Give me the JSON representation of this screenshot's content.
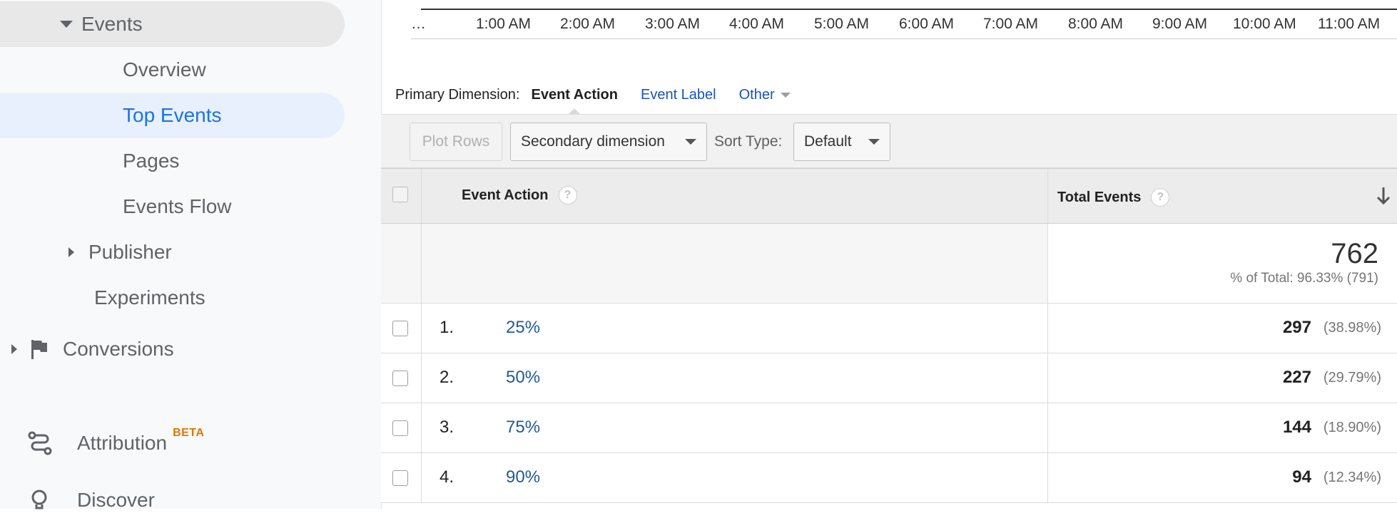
{
  "sidebar": {
    "events": "Events",
    "overview": "Overview",
    "top_events": "Top Events",
    "pages": "Pages",
    "events_flow": "Events Flow",
    "publisher": "Publisher",
    "experiments": "Experiments",
    "conversions": "Conversions",
    "attribution": "Attribution",
    "attribution_badge": "BETA",
    "discover": "Discover"
  },
  "timeline": {
    "ticks": [
      "…",
      "1:00 AM",
      "2:00 AM",
      "3:00 AM",
      "4:00 AM",
      "5:00 AM",
      "6:00 AM",
      "7:00 AM",
      "8:00 AM",
      "9:00 AM",
      "10:00 AM",
      "11:00 AM"
    ]
  },
  "primary_dimension": {
    "label": "Primary Dimension:",
    "active": "Event Action",
    "event_label": "Event Label",
    "other": "Other"
  },
  "toolbar": {
    "plot_rows": "Plot Rows",
    "secondary_dimension": "Secondary dimension",
    "sort_type_label": "Sort Type:",
    "sort_type_value": "Default"
  },
  "table": {
    "col_action": "Event Action",
    "col_total": "Total Events",
    "help_glyph": "?",
    "summary_total": "762",
    "summary_pct": "% of Total: 96.33% (791)",
    "rows": [
      {
        "rank": "1.",
        "action": "25%",
        "value": "297",
        "pct": "(38.98%)"
      },
      {
        "rank": "2.",
        "action": "50%",
        "value": "227",
        "pct": "(29.79%)"
      },
      {
        "rank": "3.",
        "action": "75%",
        "value": "144",
        "pct": "(18.90%)"
      },
      {
        "rank": "4.",
        "action": "90%",
        "value": "94",
        "pct": "(12.34%)"
      }
    ]
  }
}
